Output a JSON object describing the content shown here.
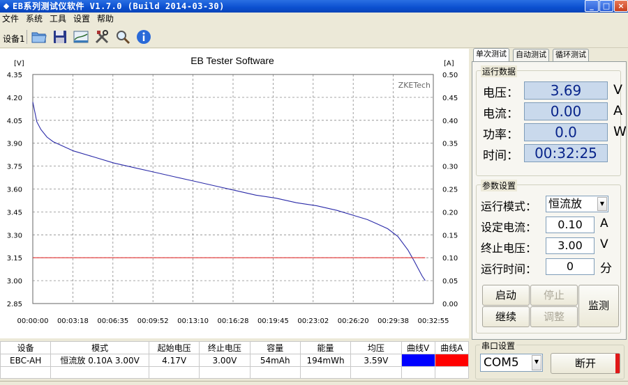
{
  "window": {
    "title": "EB系列测试仪软件 V1.7.0 (Build 2014-03-30)"
  },
  "menu": [
    "文件",
    "系统",
    "工具",
    "设置",
    "帮助"
  ],
  "toolbar": {
    "device_label": "设备1"
  },
  "chart_data": {
    "type": "line",
    "title": "EB Tester Software",
    "watermark": "ZKETech",
    "left_axis_unit": "[V]",
    "right_axis_unit": "[A]",
    "ylim_left": [
      2.85,
      4.35
    ],
    "ylim_right": [
      0.0,
      0.5
    ],
    "y_ticks_left": [
      "4.35",
      "4.20",
      "4.05",
      "3.90",
      "3.75",
      "3.60",
      "3.45",
      "3.30",
      "3.15",
      "3.00",
      "2.85"
    ],
    "y_ticks_right": [
      "0.50",
      "0.45",
      "0.40",
      "0.35",
      "0.30",
      "0.25",
      "0.20",
      "0.15",
      "0.10",
      "0.05",
      "0.00"
    ],
    "x_ticks": [
      "00:00:00",
      "00:03:18",
      "00:06:35",
      "00:09:52",
      "00:13:10",
      "00:16:28",
      "00:19:45",
      "00:23:02",
      "00:26:20",
      "00:29:38",
      "00:32:55"
    ],
    "grid": true,
    "series": [
      {
        "color": "#2a2aa8",
        "axis": "left",
        "x_unit": "seconds",
        "x": [
          0,
          20,
          40,
          70,
          100,
          150,
          200,
          300,
          400,
          500,
          600,
          700,
          800,
          900,
          1000,
          1100,
          1200,
          1300,
          1400,
          1500,
          1600,
          1650,
          1700,
          1750,
          1800,
          1850,
          1880,
          1900,
          1920,
          1935
        ],
        "y": [
          4.17,
          4.04,
          3.99,
          3.94,
          3.91,
          3.88,
          3.85,
          3.81,
          3.77,
          3.74,
          3.71,
          3.68,
          3.65,
          3.62,
          3.59,
          3.56,
          3.54,
          3.51,
          3.49,
          3.46,
          3.42,
          3.4,
          3.37,
          3.34,
          3.29,
          3.2,
          3.13,
          3.08,
          3.03,
          3.0
        ]
      },
      {
        "color": "#e03030",
        "axis": "right",
        "x_unit": "seconds",
        "x": [
          0,
          1935
        ],
        "y": [
          0.1,
          0.1
        ]
      }
    ]
  },
  "tabs": [
    "单次测试",
    "自动测试",
    "循环测试"
  ],
  "run_data": {
    "title": "运行数据",
    "voltage_label": "电压：",
    "voltage": "3.69",
    "voltage_unit": "V",
    "current_label": "电流：",
    "current": "0.00",
    "current_unit": "A",
    "power_label": "功率：",
    "power": "0.0",
    "power_unit": "W",
    "time_label": "时间：",
    "time": "00:32:25"
  },
  "params": {
    "title": "参数设置",
    "mode_label": "运行模式：",
    "mode": "恒流放",
    "set_current_label": "设定电流：",
    "set_current": "0.10",
    "set_current_unit": "A",
    "end_voltage_label": "终止电压：",
    "end_voltage": "3.00",
    "end_voltage_unit": "V",
    "run_time_label": "运行时间：",
    "run_time": "0",
    "run_time_unit": "分"
  },
  "controls": {
    "start": "启动",
    "stop": "停止",
    "continue": "继续",
    "adjust": "调整",
    "monitor": "监测"
  },
  "serial": {
    "title": "串口设置",
    "port": "COM5",
    "disconnect": "断开"
  },
  "table": {
    "headers": [
      "设备",
      "模式",
      "起始电压",
      "终止电压",
      "容量",
      "能量",
      "均压",
      "曲线V",
      "曲线A"
    ],
    "row": [
      "EBC-AH",
      "恒流放 0.10A 3.00V",
      "4.17V",
      "3.00V",
      "54mAh",
      "194mWh",
      "3.59V"
    ],
    "curve_v_color": "#0000ff",
    "curve_a_color": "#ff0000"
  }
}
